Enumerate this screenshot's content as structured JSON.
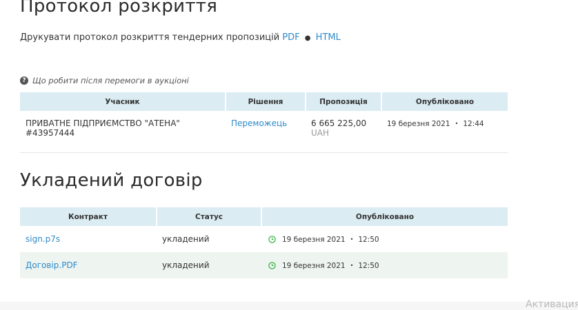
{
  "protocol": {
    "title": "Протокол розкриття",
    "print_text": "Друкувати протокол розкриття тендерних пропозицій",
    "pdf_link": "PDF",
    "separator": "●",
    "html_link": "HTML"
  },
  "help": {
    "icon": "question-circle-icon",
    "text": "Що робити після перемоги в аукціоні"
  },
  "bids_table": {
    "headers": [
      "Учасник",
      "Рішення",
      "Пропозиція",
      "Опубліковано"
    ],
    "rows": [
      {
        "participant_name": "ПРИВАТНЕ ПІДПРИЄМСТВО \"АТЕНА\"",
        "participant_code": "#43957444",
        "decision": "Переможець",
        "amount": "6 665 225,00",
        "currency": "UAH",
        "date": "19 березня 2021",
        "time": "12:44"
      }
    ]
  },
  "contract": {
    "title": "Укладений договір",
    "headers": [
      "Контракт",
      "Статус",
      "Опубліковано"
    ],
    "rows": [
      {
        "file": "sign.p7s",
        "status": "укладений",
        "date": "19 березня 2021",
        "time": "12:50"
      },
      {
        "file": "Договір.PDF",
        "status": "укладений",
        "date": "19 березня 2021",
        "time": "12:50"
      }
    ]
  },
  "watermark": {
    "text": "Активация"
  },
  "colors": {
    "link": "#2e8ac9",
    "header_bg": "#dbecf3",
    "row_alt_bg": "#eef4f0",
    "clock_green": "#3bb54a"
  }
}
